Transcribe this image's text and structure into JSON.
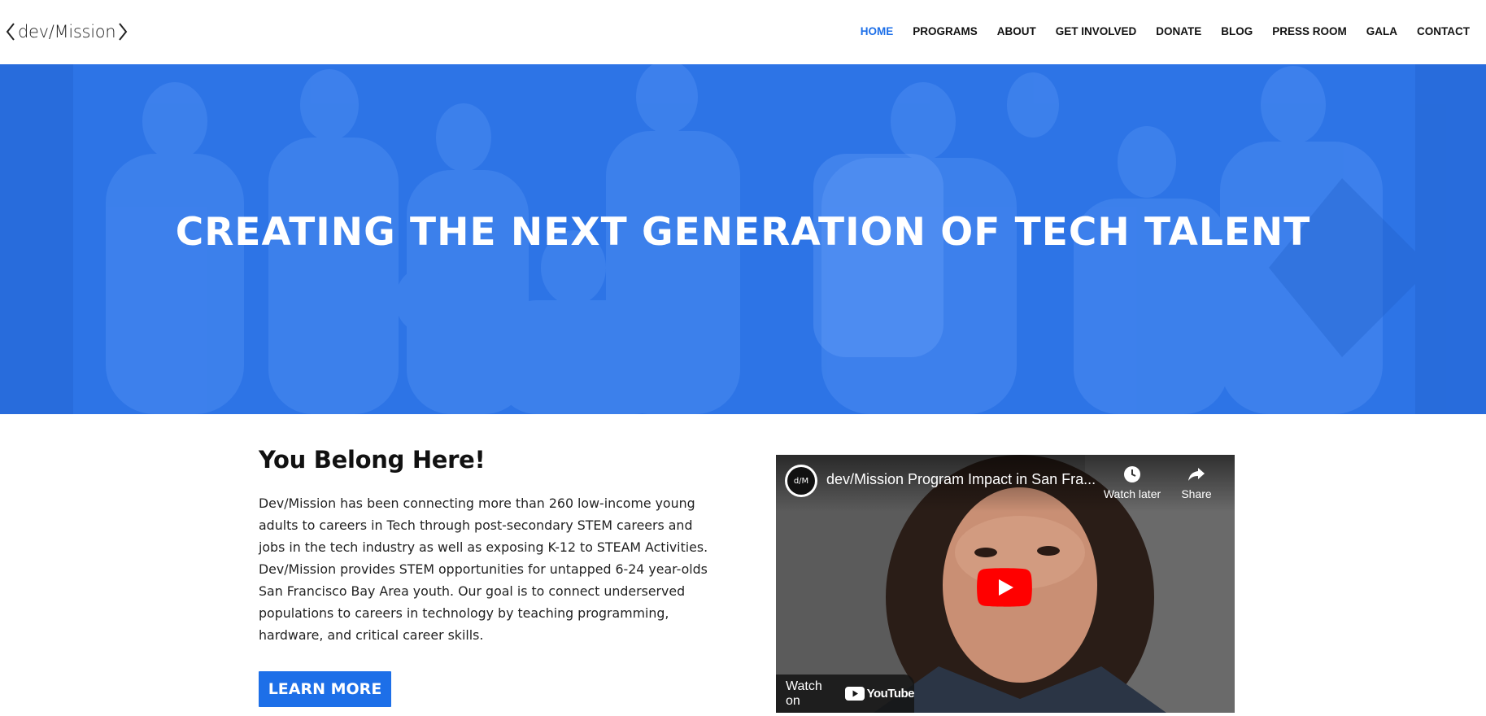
{
  "header": {
    "logo_text": "dev/Mission",
    "nav": [
      {
        "label": "HOME",
        "active": true
      },
      {
        "label": "PROGRAMS",
        "active": false
      },
      {
        "label": "ABOUT",
        "active": false
      },
      {
        "label": "GET INVOLVED",
        "active": false
      },
      {
        "label": "DONATE",
        "active": false
      },
      {
        "label": "BLOG",
        "active": false
      },
      {
        "label": "PRESS ROOM",
        "active": false
      },
      {
        "label": "GALA",
        "active": false
      },
      {
        "label": "CONTACT",
        "active": false
      }
    ]
  },
  "hero": {
    "title": "CREATING THE NEXT GENERATION OF TECH TALENT",
    "overlay_color": "#2a72e3"
  },
  "intro": {
    "heading": "You Belong Here!",
    "paragraph_lines": [
      "Dev/Mission has been connecting more than 260 low-income young",
      "adults to careers in Tech through post-secondary STEM careers and",
      "jobs in the tech industry as well as exposing K-12 to STEAM Activities.",
      "Dev/Mission provides STEM opportunities for untapped 6-24 year-olds",
      "San Francisco Bay Area youth. Our goal is to connect underserved",
      "populations to careers in technology by teaching programming,",
      "hardware, and critical career skills."
    ],
    "button_label": "LEARN MORE"
  },
  "video": {
    "channel_badge": "d/M",
    "title": "dev/Mission Program Impact in San Fra...",
    "watch_later_label": "Watch later",
    "share_label": "Share",
    "watch_on_label": "Watch on",
    "youtube_label": "YouTube"
  },
  "colors": {
    "accent": "#1d6fe8",
    "youtube_red": "#ff0000"
  },
  "icons": [
    "logo-chevron-left-icon",
    "logo-chevron-right-icon",
    "clock-icon",
    "share-arrow-icon",
    "play-icon",
    "youtube-icon"
  ]
}
